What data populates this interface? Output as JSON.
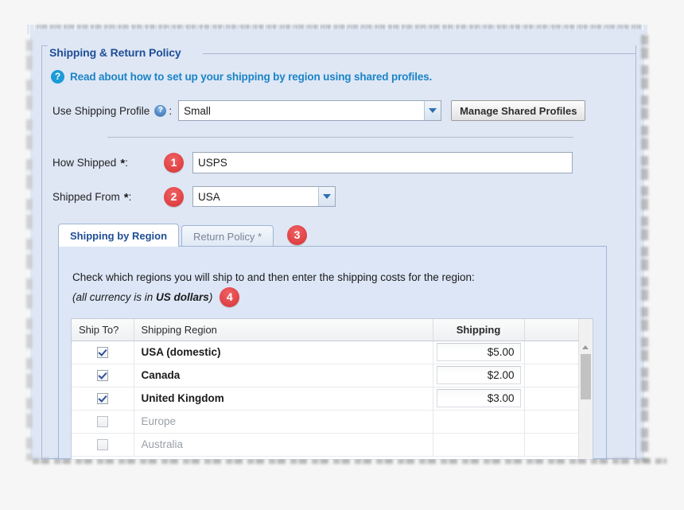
{
  "panel": {
    "legend": "Shipping & Return Policy"
  },
  "help_link": {
    "icon": "help-circle-icon",
    "text": "Read about how to set up your shipping by region using shared profiles."
  },
  "profile_row": {
    "label": "Use Shipping Profile",
    "help_icon": "help-circle-icon",
    "colon": ":",
    "selected_value": "Small",
    "manage_button": "Manage Shared Profiles"
  },
  "fields": [
    {
      "label": "How Shipped",
      "required_marker": "*",
      "colon": ":",
      "badge": "1",
      "value": "USPS",
      "control": "text"
    },
    {
      "label": "Shipped From",
      "required_marker": "*",
      "colon": ":",
      "badge": "2",
      "value": "USA",
      "control": "select"
    }
  ],
  "tabs": {
    "items": [
      {
        "label": "Shipping by Region",
        "active": true
      },
      {
        "label": "Return Policy *",
        "active": false
      }
    ],
    "badge": "3"
  },
  "instructions": {
    "line1": "Check which regions you will ship to and then enter the shipping costs for the region:",
    "line2_prefix": "(all currency is in ",
    "line2_bold": "US dollars",
    "line2_suffix": ")",
    "badge": "4"
  },
  "table": {
    "headers": {
      "ship_to": "Ship To?",
      "region": "Shipping Region",
      "shipping": "Shipping",
      "spacer": ""
    },
    "rows": [
      {
        "checked": true,
        "region": "USA (domestic)",
        "price": "$5.00"
      },
      {
        "checked": true,
        "region": "Canada",
        "price": "$2.00"
      },
      {
        "checked": true,
        "region": "United Kingdom",
        "price": "$3.00"
      },
      {
        "checked": false,
        "region": "Europe",
        "price": ""
      },
      {
        "checked": false,
        "region": "Australia",
        "price": ""
      }
    ]
  },
  "colors": {
    "badge_red": "#e3474a",
    "link_blue": "#1b84c6",
    "legend_navy": "#1f4e96",
    "panel_blue": "#dfe7f5"
  }
}
